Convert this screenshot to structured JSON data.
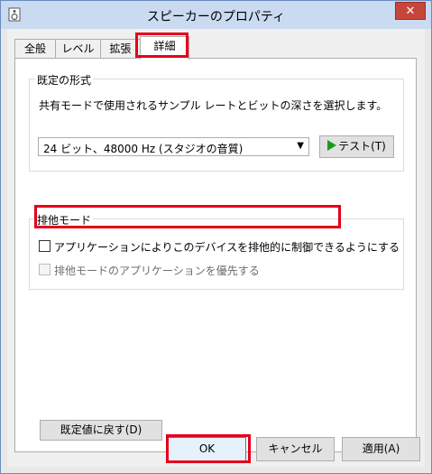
{
  "window": {
    "title": "スピーカーのプロパティ",
    "close_label": "✕"
  },
  "tabs": [
    {
      "label": "全般"
    },
    {
      "label": "レベル"
    },
    {
      "label": "拡張"
    },
    {
      "label": "詳細",
      "active": true
    }
  ],
  "default_format": {
    "group_label": "既定の形式",
    "description": "共有モードで使用されるサンプル レートとビットの深さを選択します。",
    "selected_value": "24 ビット、48000 Hz (スタジオの音質)",
    "test_button_label": "テスト(T)"
  },
  "exclusive_mode": {
    "group_label": "排他モード",
    "option1_label": "アプリケーションによりこのデバイスを排他的に制御できるようにする",
    "option1_checked": false,
    "option2_label": "排他モードのアプリケーションを優先する",
    "option2_checked": false,
    "option2_enabled": false
  },
  "buttons": {
    "restore_defaults": "既定値に戻す(D)",
    "ok": "OK",
    "cancel": "キャンセル",
    "apply": "適用(A)"
  },
  "colors": {
    "highlight": "#e5001a",
    "titlebar": "#c9daf1",
    "close": "#c7463a",
    "play_icon": "#1a9c1a"
  }
}
